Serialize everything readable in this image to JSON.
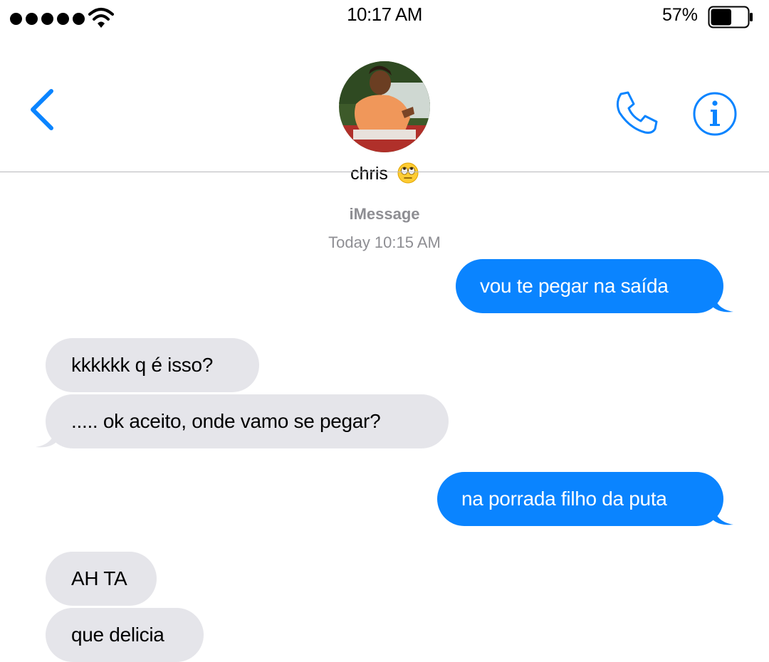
{
  "status_bar": {
    "time": "10:17 AM",
    "battery_percent": "57%",
    "battery_level": 0.57,
    "signal_bars": 5,
    "icons": [
      "signal-dots-icon",
      "wifi-icon",
      "battery-icon"
    ]
  },
  "header": {
    "contact_name": "chris",
    "contact_emoji": "🙄",
    "icons": [
      "back-chevron-icon",
      "phone-icon",
      "info-icon"
    ],
    "accent_color": "#0a84ff"
  },
  "conversation": {
    "service": "iMessage",
    "timestamp": "Today 10:15 AM",
    "messages": [
      {
        "from": "me",
        "text": "vou te pegar na saída"
      },
      {
        "from": "them",
        "text": "kkkkkk q é isso?"
      },
      {
        "from": "them",
        "text": "..... ok aceito, onde vamo se pegar?"
      },
      {
        "from": "me",
        "text": "na porrada filho da puta"
      },
      {
        "from": "them",
        "text": "AH TA"
      },
      {
        "from": "them",
        "text": "que delicia"
      }
    ]
  },
  "colors": {
    "outgoing_bubble": "#0a84ff",
    "incoming_bubble": "#e5e5ea",
    "meta_text": "#8e8e93"
  }
}
